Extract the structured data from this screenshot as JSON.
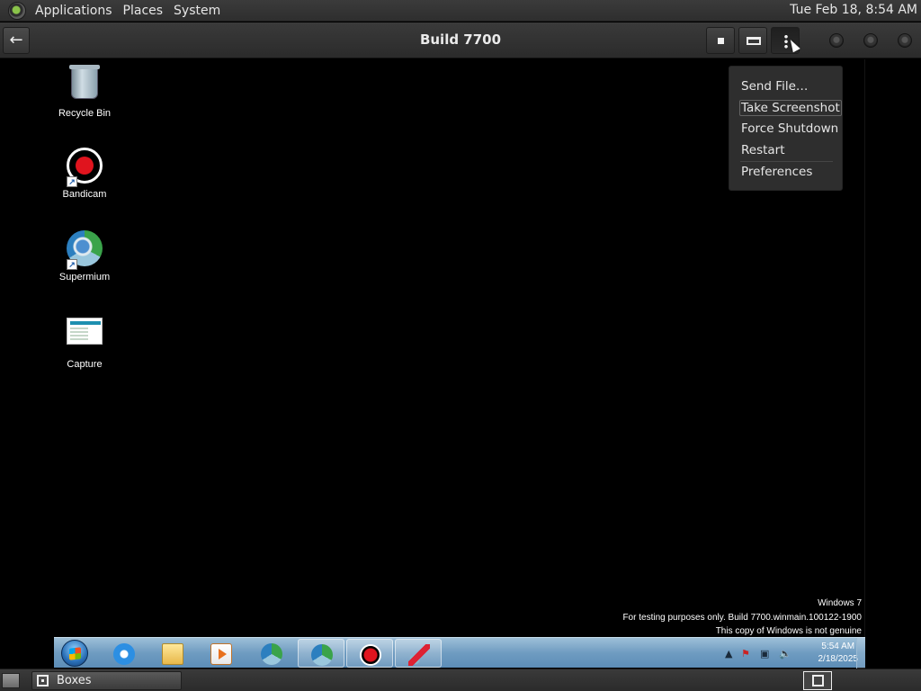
{
  "top_panel": {
    "menus": [
      "Applications",
      "Places",
      "System"
    ],
    "clock": "Tue Feb 18,  8:54 AM"
  },
  "header": {
    "back_glyph": "←",
    "title": "Build 7700"
  },
  "vm_menu": {
    "items": [
      "Send File…",
      "Take Screenshot",
      "Force Shutdown",
      "Restart",
      "Preferences"
    ],
    "highlighted": "Take Screenshot"
  },
  "desktop": {
    "icons": [
      "Recycle Bin",
      "Bandicam",
      "Supermium",
      "Capture"
    ],
    "watermark": {
      "line1": "Windows 7",
      "line2": "For testing purposes only. Build 7700.winmain.100122-1900",
      "line3": "This copy of Windows is not genuine"
    }
  },
  "taskbar": {
    "pinned": [
      "internet-explorer-icon",
      "windows-explorer-icon",
      "media-player-icon",
      "supermium-icon",
      "supermium-icon",
      "bandicam-icon",
      "snipping-tool-icon"
    ],
    "clock_time": "5:54 AM",
    "clock_date": "2/18/2025"
  },
  "bottom_panel": {
    "window_title": "Boxes"
  },
  "colors": {
    "accent_record": "#e0141e",
    "panel_bg": "#2e2e2e",
    "taskbar_blue": "#6f9cc1"
  }
}
